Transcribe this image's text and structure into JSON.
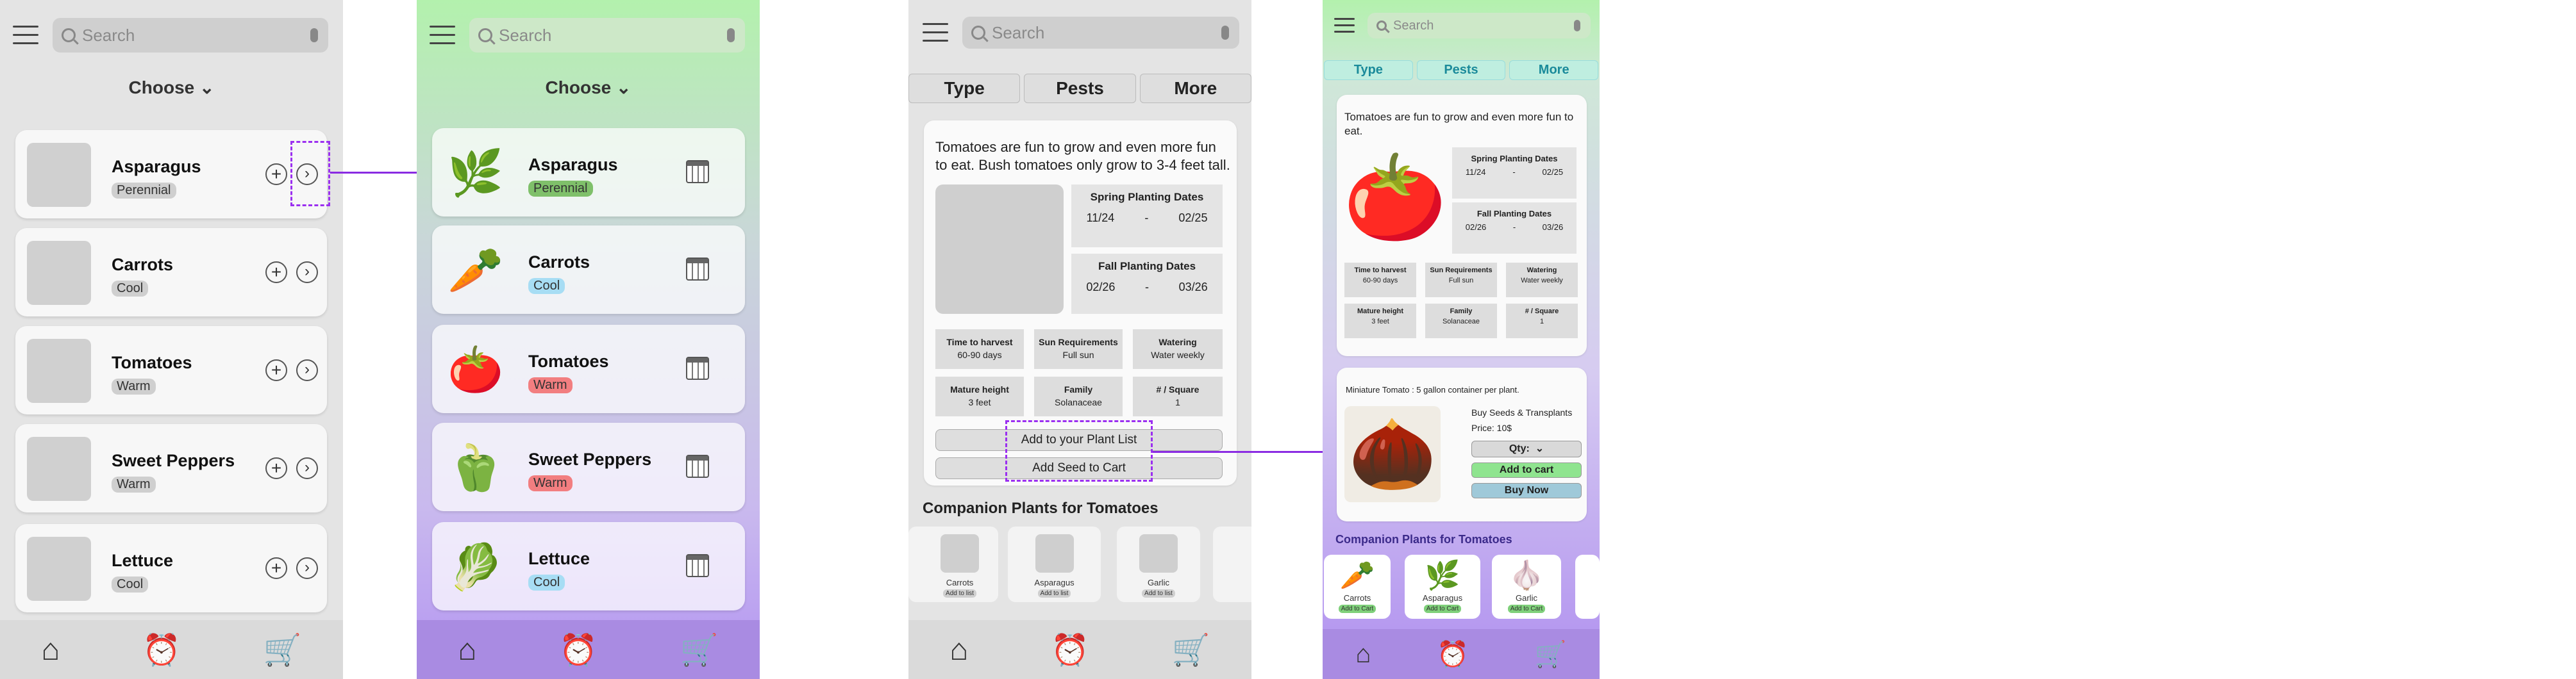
{
  "search": {
    "placeholder": "Search"
  },
  "choose_label": "Choose",
  "plants": [
    {
      "name": "Asparagus",
      "tag": "Perennial",
      "emoji": "🌿"
    },
    {
      "name": "Carrots",
      "tag": "Cool",
      "emoji": "🥕"
    },
    {
      "name": "Tomatoes",
      "tag": "Warm",
      "emoji": "🍅"
    },
    {
      "name": "Sweet Peppers",
      "tag": "Warm",
      "emoji": "🫑"
    },
    {
      "name": "Lettuce",
      "tag": "Cool",
      "emoji": "🥬"
    }
  ],
  "tabs": [
    "Type",
    "Pests",
    "More"
  ],
  "detail": {
    "description": "Tomatoes are fun to grow and even more fun to eat. Bush tomatoes only grow to 3-4 feet tall.",
    "description_short": "Tomatoes are fun to grow and even more fun to eat.",
    "spring_title": "Spring Planting Dates",
    "spring_start": "11/24",
    "spring_sep": "-",
    "spring_end": "02/25",
    "fall_title": "Fall Planting Dates",
    "fall_start": "02/26",
    "fall_sep": "-",
    "fall_end": "03/26",
    "stats": [
      {
        "label": "Time to harvest",
        "value": "60-90 days"
      },
      {
        "label": "Sun Requirements",
        "value": "Full sun"
      },
      {
        "label": "Watering",
        "value": "Water weekly"
      },
      {
        "label": "Mature height",
        "value": "3 feet"
      },
      {
        "label": "Family",
        "value": "Solanaceae"
      },
      {
        "label": "# / Square",
        "value": "1"
      }
    ],
    "add_plant_list": "Add to your Plant List",
    "add_seed_cart": "Add Seed to Cart"
  },
  "shop": {
    "note": "Miniature Tomato : 5 gallon container per plant.",
    "buy_label": "Buy Seeds & Transplants",
    "price": "Price: 10$",
    "qty": "Qty:",
    "add_to_cart": "Add to cart",
    "buy_now": "Buy Now"
  },
  "companion": {
    "title": "Companion Plants for Tomatoes",
    "items": [
      {
        "name": "Carrots",
        "btn": "Add to list",
        "emoji": "🥕"
      },
      {
        "name": "Asparagus",
        "btn": "Add to list",
        "emoji": "🌿"
      },
      {
        "name": "Garlic",
        "btn": "Add to list",
        "emoji": "🧄"
      }
    ],
    "shop_btn": "Add to Cart"
  },
  "nav": {
    "home_icon": "home-icon",
    "alarm_icon": "alarm-clock-icon",
    "cart_icon": "cart-icon"
  },
  "colors": {
    "accent": "#8a2be2",
    "perennial": "#7fc06a",
    "cool": "#a7ddf4",
    "warm": "#f27e80"
  }
}
